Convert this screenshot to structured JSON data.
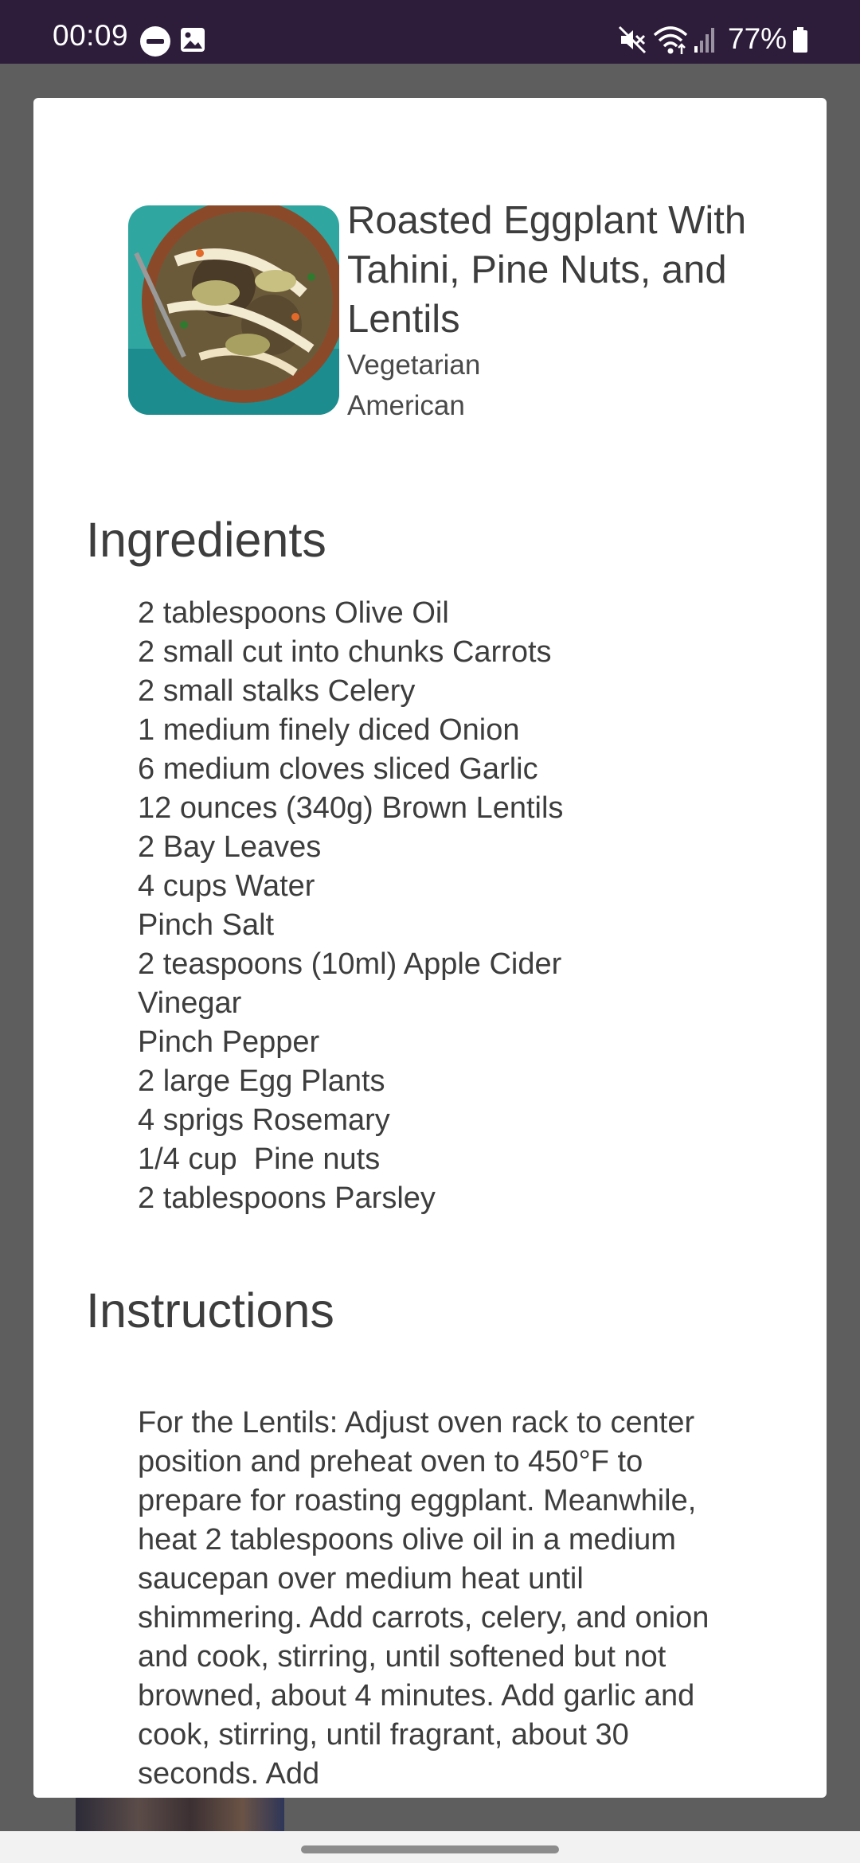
{
  "status_bar": {
    "time": "00:09",
    "battery": "77%",
    "icons": [
      "do-not-disturb-icon",
      "gallery-icon",
      "mute-icon",
      "wifi-icon",
      "signal-icon",
      "battery-icon"
    ]
  },
  "recipe": {
    "title": "Roasted Eggplant With Tahini, Pine Nuts, and Lentils",
    "tags": [
      "Vegetarian",
      "American"
    ],
    "ingredients_heading": "Ingredients",
    "ingredients": [
      "2 tablespoons Olive Oil",
      "2 small cut into chunks Carrots",
      "2 small stalks Celery",
      "1 medium finely diced Onion",
      "6 medium cloves sliced Garlic",
      "12 ounces (340g) Brown Lentils",
      "2 Bay Leaves",
      "4 cups Water",
      "Pinch Salt",
      "2 teaspoons (10ml) Apple Cider Vinegar",
      "Pinch Pepper",
      "2 large Egg Plants",
      "4 sprigs Rosemary",
      "1/4 cup  Pine nuts",
      "2 tablespoons Parsley"
    ],
    "instructions_heading": "Instructions",
    "instructions": "For the Lentils: Adjust oven rack to center position and preheat oven to 450°F to prepare for roasting eggplant. Meanwhile, heat 2 tablespoons olive oil in a medium saucepan over medium heat until shimmering. Add carrots, celery, and onion and cook, stirring, until softened but not browned, about 4 minutes. Add garlic and cook, stirring, until fragrant, about 30 seconds. Add"
  },
  "colors": {
    "status_bar": "#2d1d3b",
    "scrim": "#5e5e5e",
    "card": "#ffffff",
    "text": "#3d3d3d"
  }
}
